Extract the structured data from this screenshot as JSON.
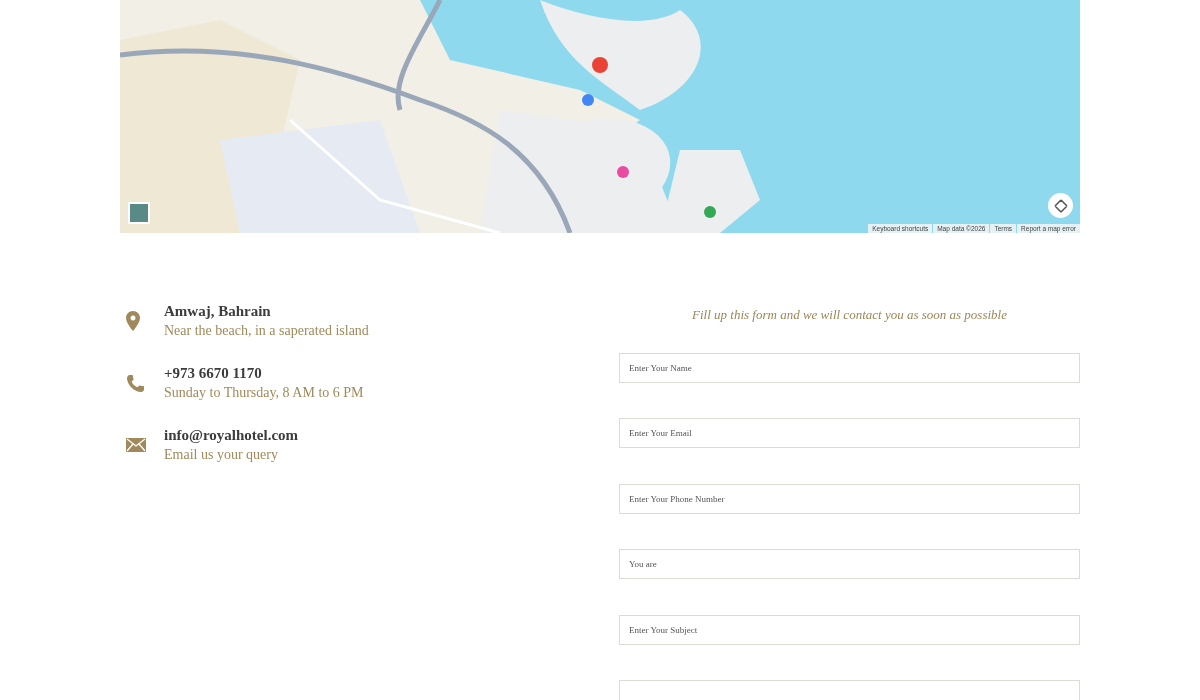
{
  "map": {
    "kind": "picture",
    "attribution": [
      "Keyboard shortcuts",
      "Map data ©2026",
      "Terms",
      "Report a map error"
    ]
  },
  "contacts": [
    {
      "kind": "location",
      "title": "Amwaj, Bahrain",
      "subtitle": "Near the beach, in a saperated island"
    },
    {
      "kind": "phone",
      "title": "+973 6670 1170",
      "subtitle": "Sunday to Thursday, 8 AM to 6 PM"
    },
    {
      "kind": "email",
      "title": "info@royalhotel.com",
      "subtitle": "Email us your query"
    }
  ],
  "form": {
    "heading": "Fill up this form and we will contact you as soon as possible",
    "fields": [
      {
        "kind": "input",
        "placeholder": "Enter Your Name"
      },
      {
        "kind": "input",
        "placeholder": "Enter Your Email"
      },
      {
        "kind": "input",
        "placeholder": "Enter Your Phone Number"
      },
      {
        "kind": "input",
        "placeholder": "You are"
      },
      {
        "kind": "input",
        "placeholder": "Enter Your Subject"
      },
      {
        "kind": "input"
      }
    ]
  }
}
